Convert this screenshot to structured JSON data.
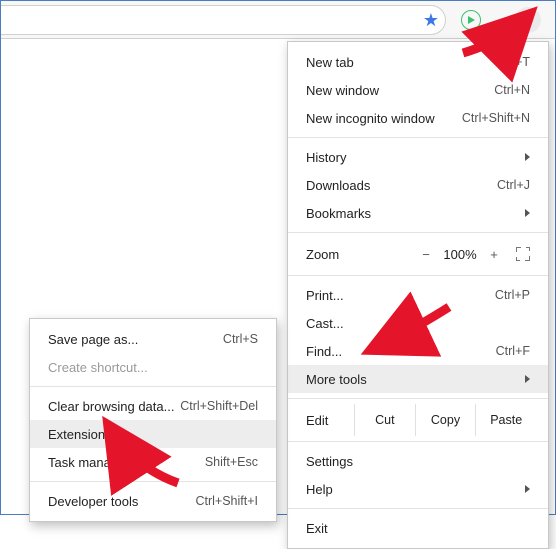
{
  "colors": {
    "arrow": "#e4142a",
    "highlight": "#ededed"
  },
  "main_menu": {
    "new_tab": {
      "label": "New tab",
      "shortcut": "Ctrl+T"
    },
    "new_window": {
      "label": "New window",
      "shortcut": "Ctrl+N"
    },
    "incognito": {
      "label": "New incognito window",
      "shortcut": "Ctrl+Shift+N"
    },
    "history": {
      "label": "History"
    },
    "downloads": {
      "label": "Downloads",
      "shortcut": "Ctrl+J"
    },
    "bookmarks": {
      "label": "Bookmarks"
    },
    "zoom": {
      "label": "Zoom",
      "minus": "−",
      "value": "100%",
      "plus": "+"
    },
    "print": {
      "label": "Print...",
      "shortcut": "Ctrl+P"
    },
    "cast": {
      "label": "Cast..."
    },
    "find": {
      "label": "Find...",
      "shortcut": "Ctrl+F"
    },
    "more_tools": {
      "label": "More tools"
    },
    "edit": {
      "label": "Edit",
      "cut": "Cut",
      "copy": "Copy",
      "paste": "Paste"
    },
    "settings": {
      "label": "Settings"
    },
    "help": {
      "label": "Help"
    },
    "exit": {
      "label": "Exit"
    }
  },
  "sub_menu": {
    "save_page": {
      "label": "Save page as...",
      "shortcut": "Ctrl+S"
    },
    "create_shortcut": {
      "label": "Create shortcut..."
    },
    "clear_data": {
      "label": "Clear browsing data...",
      "shortcut": "Ctrl+Shift+Del"
    },
    "extensions": {
      "label": "Extensions"
    },
    "task_manager": {
      "label": "Task manager",
      "shortcut": "Shift+Esc"
    },
    "dev_tools": {
      "label": "Developer tools",
      "shortcut": "Ctrl+Shift+I"
    }
  }
}
